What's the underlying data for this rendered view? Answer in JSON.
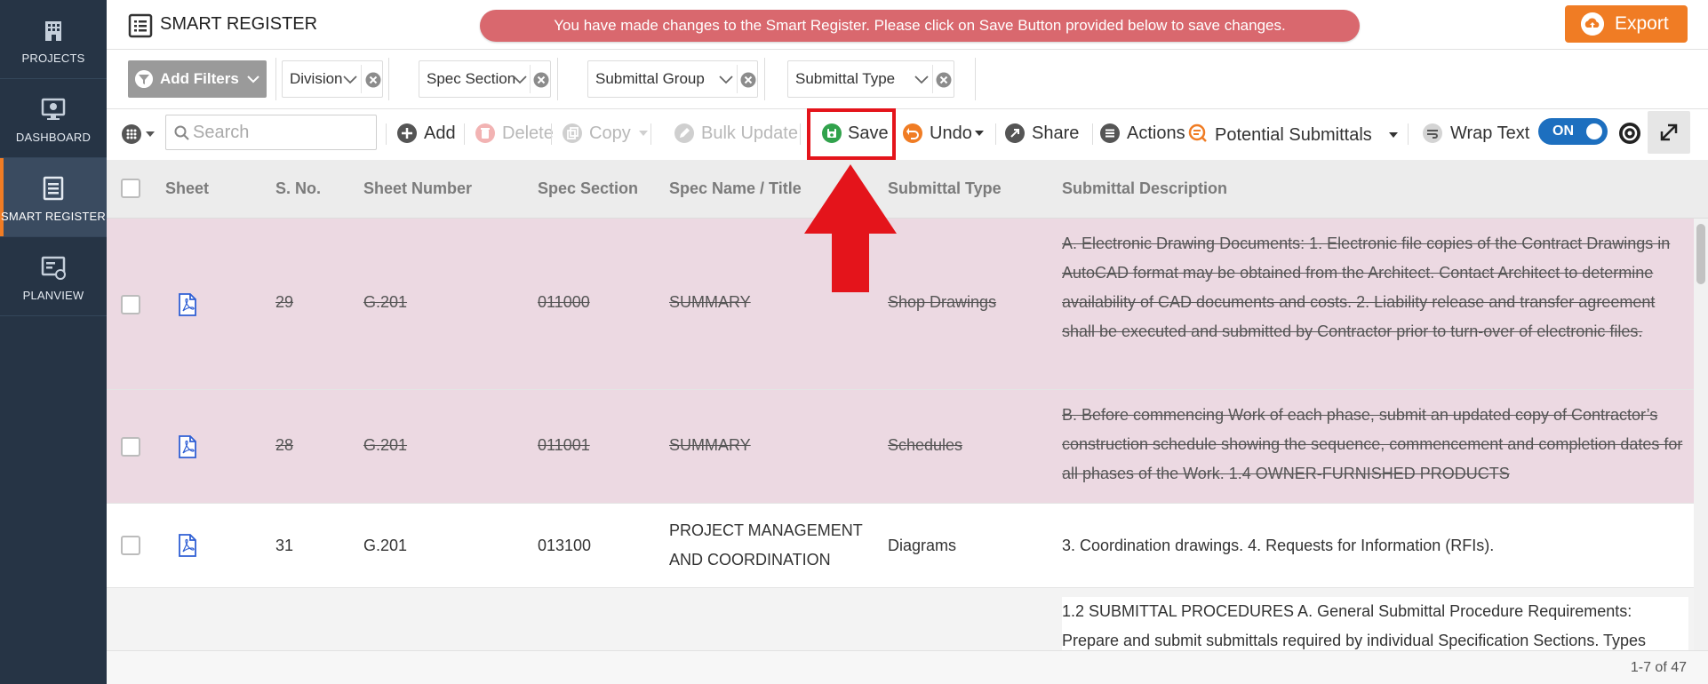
{
  "sidebar": {
    "items": [
      {
        "label": "PROJECTS",
        "icon": "building-icon"
      },
      {
        "label": "DASHBOARD",
        "icon": "monitor-icon"
      },
      {
        "label": "SMART REGISTER",
        "icon": "register-icon",
        "active": true
      },
      {
        "label": "PLANVIEW",
        "icon": "planview-icon"
      }
    ]
  },
  "header": {
    "title": "SMART REGISTER",
    "alert": "You have made changes to the Smart Register. Please click on Save Button provided below to save changes.",
    "export_label": "Export"
  },
  "filters": {
    "add_label": "Add Filters",
    "chips": [
      "Division",
      "Spec Section",
      "Submittal Group",
      "Submittal Type"
    ]
  },
  "toolbar": {
    "search_placeholder": "Search",
    "add": "Add",
    "delete": "Delete",
    "copy": "Copy",
    "bulk_update": "Bulk Update",
    "save": "Save",
    "undo": "Undo",
    "share": "Share",
    "actions": "Actions",
    "potential_submittals": "Potential Submittals",
    "wrap_text": "Wrap Text",
    "wrap_toggle": "ON"
  },
  "grid": {
    "columns": [
      "Sheet",
      "S. No.",
      "Sheet Number",
      "Spec Section",
      "Spec Name / Title",
      "Submittal Type",
      "Submittal Description"
    ],
    "rows": [
      {
        "changed": true,
        "sno": "29",
        "sheet_number": "G.201",
        "spec_section": "011000",
        "spec_name": "SUMMARY",
        "submittal_type": "Shop Drawings",
        "description": "A. Electronic Drawing Documents: 1. Electronic file copies of the Contract Drawings in AutoCAD format may be obtained from the Architect. Contact Architect to determine availability of CAD documents and costs. 2. Liability release and transfer agreement shall be executed and submitted by Contractor prior to turn-over of electronic files."
      },
      {
        "changed": true,
        "sno": "28",
        "sheet_number": "G.201",
        "spec_section": "011001",
        "spec_name": "SUMMARY",
        "submittal_type": "Schedules",
        "description": "B. Before commencing Work of each phase, submit an updated copy of Contractor’s construction schedule showing the sequence, commencement and completion dates for all phases of the Work. 1.4 OWNER-FURNISHED PRODUCTS"
      },
      {
        "changed": false,
        "sno": "31",
        "sheet_number": "G.201",
        "spec_section": "013100",
        "spec_name": "PROJECT MANAGEMENT AND COORDINATION",
        "submittal_type": "Diagrams",
        "description": "3. Coordination drawings. 4. Requests for Information (RFIs)."
      },
      {
        "changed": false,
        "sno": "",
        "sheet_number": "",
        "spec_section": "",
        "spec_name": "",
        "submittal_type": "",
        "description": "1.2 SUBMITTAL PROCEDURES A. General Submittal Procedure Requirements: Prepare and submit submittals required by individual Specification Sections. Types"
      }
    ]
  },
  "footer": {
    "pager": "1-7 of 47"
  },
  "colors": {
    "sidebar": "#263445",
    "accent": "#f07c24",
    "alert": "#d9686e",
    "changed_row": "#ecd9e2",
    "highlight": "#e4141b",
    "toggle": "#1d6fbf"
  }
}
